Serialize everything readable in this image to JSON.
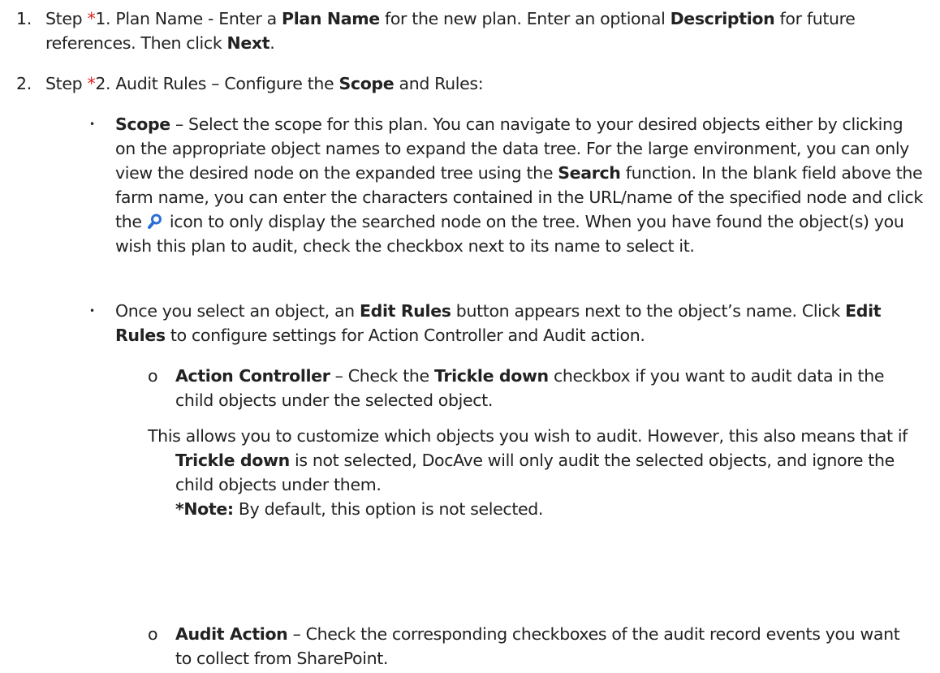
{
  "items": {
    "step1": {
      "number": "1.",
      "t1": "Step ",
      "star": "*",
      "t2": "1. Plan Name - Enter a ",
      "b1": "Plan Name",
      "t3": " for the new plan. Enter an optional ",
      "b2": "Description",
      "t4": " for future references. Then click ",
      "b3": "Next",
      "t5": "."
    },
    "step2": {
      "number": "2.",
      "t1": "Step ",
      "star": "*",
      "t2": "2. Audit Rules – Configure the ",
      "b1": "Scope",
      "t3": " and Rules:"
    },
    "scope": {
      "bullet": "•",
      "b1": "Scope",
      "t1": " – Select the scope for this plan. You can navigate to your desired objects either by clicking on the appropriate object names to expand the data tree. For the large environment, you can only view the desired node on the expanded tree using the ",
      "b2": "Search",
      "t2": " function. In the blank field above the farm name, you can enter the characters contained in the URL/name of the specified node and click the ",
      "t3": " icon to only display the searched node on the tree. When you have found the object(s) you wish this plan to audit, check the checkbox next to its name to select it."
    },
    "edit_rules": {
      "bullet": "•",
      "t1": "Once you select an object, an ",
      "b1": "Edit Rules",
      "t2": " button appears next to the object’s name. Click ",
      "b2": "Edit Rules",
      "t3": " to configure settings for Action Controller and Audit action."
    },
    "action_controller": {
      "bullet": "o",
      "b1": "Action Controller",
      "t1": " – Check the ",
      "b2": "Trickle down",
      "t2": " checkbox if you want to audit data in the child objects under the selected object."
    },
    "trickle_note": {
      "t1": "This allows you to customize which objects you wish to audit. However, this also means that if ",
      "b1": "Trickle down",
      "t2": " is not selected, DocAve will only audit the selected objects, and ignore the child objects under them.",
      "note_label": "*Note:",
      "note_text": " By default, this option is not selected."
    },
    "audit_action": {
      "bullet": "o",
      "b1": "Audit Action",
      "t1": " – Check the corresponding checkboxes of the audit record events you want to collect from SharePoint."
    }
  },
  "icons": {
    "search": "magnifier-icon"
  },
  "colors": {
    "star": "#e02020",
    "icon": "#2a6fd6"
  }
}
